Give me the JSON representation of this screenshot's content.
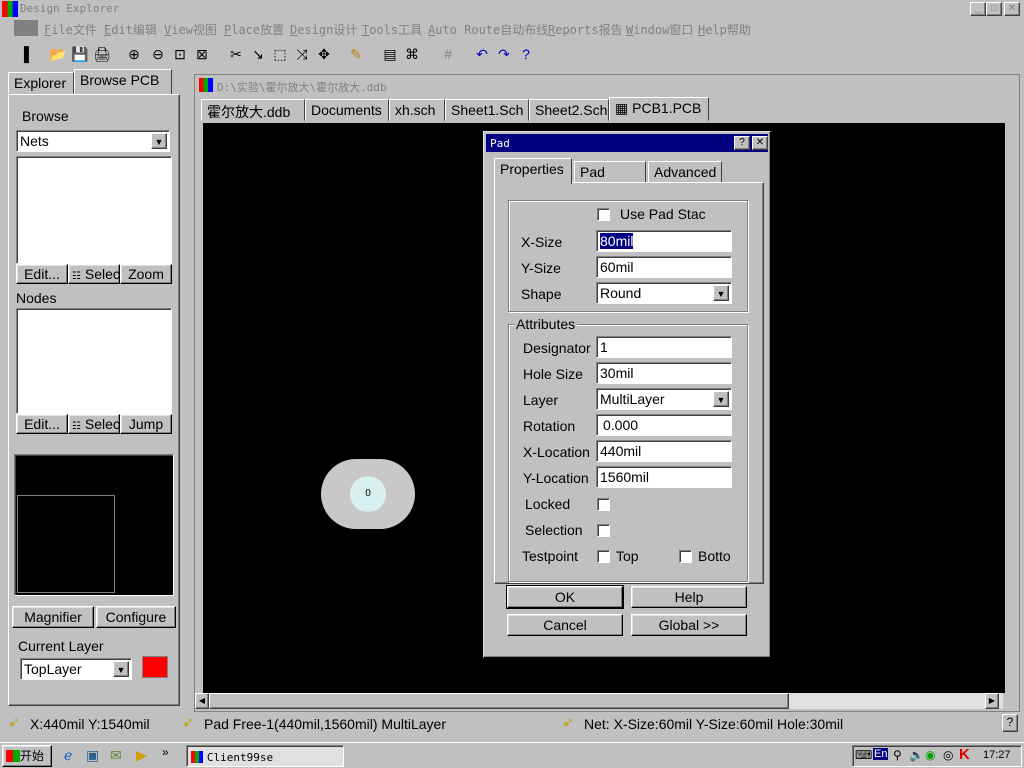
{
  "app": {
    "title": "Design Explorer",
    "controls": {
      "minimize": "_",
      "maximize": "□",
      "close": "✕"
    }
  },
  "menu": [
    {
      "key": "F",
      "rest": "ile文件"
    },
    {
      "key": "E",
      "rest": "dit编辑"
    },
    {
      "key": "V",
      "rest": "iew视图"
    },
    {
      "key": "P",
      "rest": "lace放置"
    },
    {
      "key": "D",
      "rest": "esign设计"
    },
    {
      "key": "T",
      "rest": "ools工具"
    },
    {
      "key": "A",
      "rest": "uto Route自动布线"
    },
    {
      "key": "R",
      "rest": "eports报告"
    },
    {
      "key": "W",
      "rest": "indow窗口"
    },
    {
      "key": "H",
      "rest": "elp帮助"
    }
  ],
  "toolbar": {
    "icons": [
      "panel-toggle-icon",
      "open-folder-icon",
      "save-icon",
      "print-icon",
      "zoom-in-icon",
      "zoom-out-icon",
      "zoom-fit-icon",
      "zoom-area-icon",
      "route-icon",
      "wire-icon",
      "select-rect-icon",
      "deselect-icon",
      "move-icon",
      "pencil-icon",
      "library-icon",
      "browse-library-icon",
      "grid-icon",
      "undo-icon",
      "redo-icon",
      "help-icon"
    ],
    "glyphs": [
      "▐",
      "📂",
      "💾",
      "🖨",
      "⊕",
      "⊖",
      "⊡",
      "⊠",
      "✂",
      "↘",
      "⬚",
      "⤨",
      "✥",
      "✎",
      "▤",
      "⌘",
      "#",
      "↶",
      "↷",
      "?"
    ]
  },
  "left_panel": {
    "tabs": [
      "Explorer",
      "Browse PCB"
    ],
    "active_tab": "Browse PCB",
    "browse_label": "Browse",
    "browse_select": "Nets",
    "nets_buttons": [
      "Edit...",
      "Selec",
      "Zoom"
    ],
    "nodes_label": "Nodes",
    "nodes_buttons": [
      "Edit...",
      "Selec",
      "Jump"
    ],
    "magnifier_label": "Magnifier",
    "configure_label": "Configure",
    "current_layer_label": "Current Layer",
    "current_layer_value": "TopLayer",
    "layer_color": "#ff0000"
  },
  "document": {
    "path": "D:\\实验\\霍尔放大\\霍尔放大.ddb",
    "tabs": [
      "霍尔放大.ddb",
      "Documents",
      "xh.sch",
      "Sheet1.Sch",
      "Sheet2.Sch",
      "PCB1.PCB"
    ],
    "active_tab": "PCB1.PCB",
    "pad_label": "0"
  },
  "dialog": {
    "title": "Pad",
    "help_btn": "?",
    "close_btn": "✕",
    "tabs": [
      "Properties",
      "Pad Stack",
      "Advanced"
    ],
    "active_tab": "Properties",
    "use_pad_stack": "Use Pad Stac",
    "x_size_label": "X-Size",
    "x_size": "80mil",
    "y_size_label": "Y-Size",
    "y_size": "60mil",
    "shape_label": "Shape",
    "shape": "Round",
    "attributes_label": "Attributes",
    "designator_label": "Designator",
    "designator": "1",
    "hole_size_label": "Hole Size",
    "hole_size": "30mil",
    "layer_label": "Layer",
    "layer": "MultiLayer",
    "rotation_label": "Rotation",
    "rotation": "0.000",
    "x_location_label": "X-Location",
    "x_location": "440mil",
    "y_location_label": "Y-Location",
    "y_location": "1560mil",
    "locked_label": "Locked",
    "selection_label": "Selection",
    "testpoint_label": "Testpoint",
    "top_label": "Top",
    "bottom_label": "Botto",
    "ok": "OK",
    "help": "Help",
    "cancel": "Cancel",
    "global": "Global >>"
  },
  "statusbar": {
    "coords": "X:440mil Y:1540mil",
    "pad_info": "Pad Free-1(440mil,1560mil)  MultiLayer",
    "net_info": "Net: X-Size:60mil Y-Size:60mil Hole:30mil",
    "help_icon": "?"
  },
  "taskbar": {
    "start": "开始",
    "task": "Client99se",
    "time": "17:27",
    "tray": [
      "En"
    ]
  },
  "colors": {
    "face": "#c0c0c0",
    "canvas": "#000000",
    "pad_fill": "#c8c8c8",
    "hole_fill": "#d8f0f0",
    "select_highlight": "#000080"
  }
}
